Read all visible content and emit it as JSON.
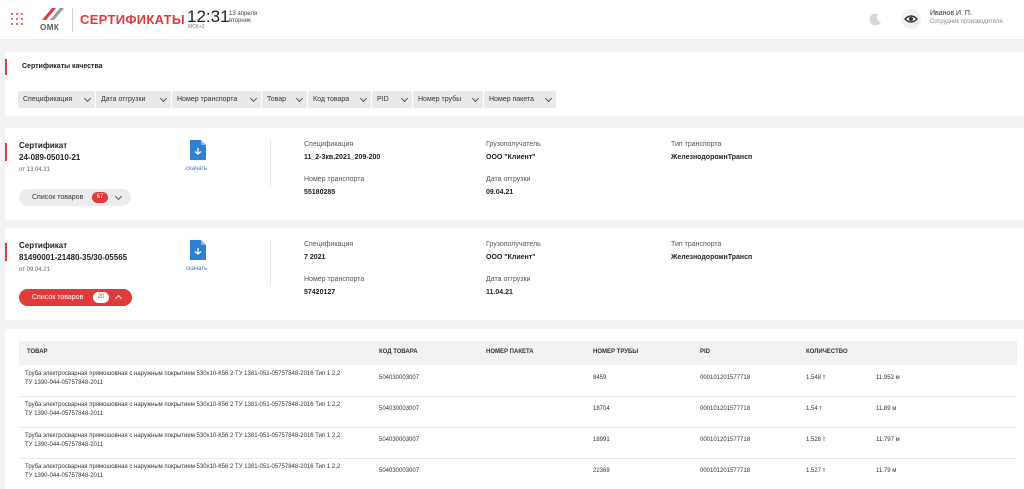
{
  "header": {
    "brand": "ОМК",
    "app_title": "СЕРТИФИКАТЫ",
    "time": "12:31",
    "timezone": "МСК+3",
    "date_line1": "13 апреля",
    "date_line2": "вторник",
    "user_name": "Иванов И. П.",
    "user_role": "Сотрудник производителя",
    "icons": [
      "apps-grid-icon",
      "omk-logo",
      "moon-icon",
      "eye-icon"
    ]
  },
  "filters": {
    "title": "Сертификаты качества",
    "items": [
      "Спецификация",
      "Дата отгрузки",
      "Номер транспорта",
      "Товар",
      "Код товара",
      "PID",
      "Номер трубы",
      "Номер пакета"
    ]
  },
  "cards": [
    {
      "label": "Сертификат",
      "number": "24-089-05010-21",
      "date": "от 13.04.21",
      "download": "скачать",
      "spec_label": "Спецификация",
      "spec": "11_2-3кв.2021_209-200",
      "transport_label": "Номер транспорта",
      "transport": "55180285",
      "consignee_label": "Грузополучатель",
      "consignee": "ООО \"Клиент\"",
      "ship_date_label": "Дата отгрузки",
      "ship_date": "09.04.21",
      "transport_type_label": "Тип транспорта",
      "transport_type": "ЖелезнодорожнТрансп",
      "goods_button": "Список товаров",
      "goods_count": "67"
    },
    {
      "label": "Сертификат",
      "number": "81490001-21480-35/30-05565",
      "date": "от 09.04.21",
      "download": "скачать",
      "spec_label": "Спецификация",
      "spec": "7 2021",
      "transport_label": "Номер транспорта",
      "transport": "57420127",
      "consignee_label": "Грузополучатель",
      "consignee": "ООО \"Клиент\"",
      "ship_date_label": "Дата отгрузки",
      "ship_date": "11.04.21",
      "transport_type_label": "Тип транспорта",
      "transport_type": "ЖелезнодорожнТрансп",
      "goods_button": "Список товаров",
      "goods_count": "20"
    }
  ],
  "table": {
    "columns": [
      "ТОВАР",
      "КОД ТОВАРА",
      "НОМЕР ПАКЕТА",
      "НОМЕР ТРУБЫ",
      "PID",
      "КОЛИЧЕСТВО"
    ],
    "rows": [
      {
        "name1": "Труба электросварная прямошовная с наружным покрытием 530х10-К56 2 ТУ 1381-051-05757848-2016 Тип 1 2,2",
        "name2": "ТУ 1390-044-05757848-2011",
        "code": "504030003007",
        "package": "",
        "pipe": "8459",
        "pid": "000101201577718",
        "qty": "1.548 т",
        "len": "11.952 м"
      },
      {
        "name1": "Труба электросварная прямошовная с наружным покрытием 530х10-К56 2 ТУ 1381-051-05757848-2016 Тип 1 2,2",
        "name2": "ТУ 1390-044-05757848-2011",
        "code": "504030003007",
        "package": "",
        "pipe": "18704",
        "pid": "000101201577718",
        "qty": "1.54 т",
        "len": "11.89 м"
      },
      {
        "name1": "Труба электросварная прямошовная с наружным покрытием 530х10-К56 2 ТУ 1381-051-05757848-2016 Тип 1 2,2",
        "name2": "ТУ 1390-044-05757848-2011",
        "code": "504030003007",
        "package": "",
        "pipe": "18991",
        "pid": "000101201577718",
        "qty": "1.528 т",
        "len": "11.797 м"
      },
      {
        "name1": "Труба электросварная прямошовная с наружным покрытием 530х10-К56 2 ТУ 1381-051-05757848-2016 Тип 1 2,2",
        "name2": "ТУ 1390-044-05757848-2011",
        "code": "504030003007",
        "package": "",
        "pipe": "22369",
        "pid": "000101201577718",
        "qty": "1.527 т",
        "len": "11.79 м"
      }
    ]
  },
  "colors": {
    "accent": "#e03a3a",
    "link": "#3a7bd5",
    "doc_icon": "#2f80d1"
  }
}
